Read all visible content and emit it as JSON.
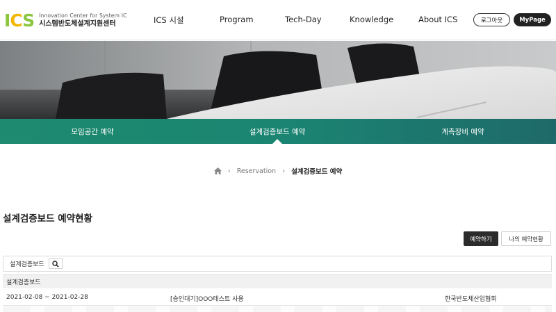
{
  "header": {
    "logo_mark_1": "I",
    "logo_mark_2": "C",
    "logo_mark_3": "S",
    "logo_en": "Innovation Center for System IC",
    "logo_ko": "시스템반도체설계지원센터",
    "nav": [
      "ICS 시설",
      "Program",
      "Tech-Day",
      "Knowledge",
      "About ICS"
    ],
    "logout_label": "로그아웃",
    "mypage_label": "MyPage"
  },
  "tabs": {
    "items": [
      "모임공간 예약",
      "설계검증보드 예약",
      "계측장비 예약"
    ],
    "active_index": 1
  },
  "breadcrumb": {
    "home_icon": "home-icon",
    "item1": "Reservation",
    "current": "설계검증보드 예약"
  },
  "page": {
    "title": "설계검증보드 예약현황",
    "reserve_label": "예약하기",
    "my_reservation_label": "나의 예약현황"
  },
  "filter": {
    "label": "설계검증보드",
    "search_icon": "search-icon"
  },
  "table": {
    "group_label": "설계검증보드",
    "rows": [
      {
        "period": "2021-02-08 ~ 2021-02-28",
        "title": "[승인대기]OOO테스트 사용",
        "org": "한국반도체산업협회"
      }
    ]
  },
  "colors": {
    "tab_bar": "#1b8572",
    "logo_green": "#8cc63f",
    "logo_yellow": "#f2b705",
    "dark_button": "#2b2b2b"
  }
}
